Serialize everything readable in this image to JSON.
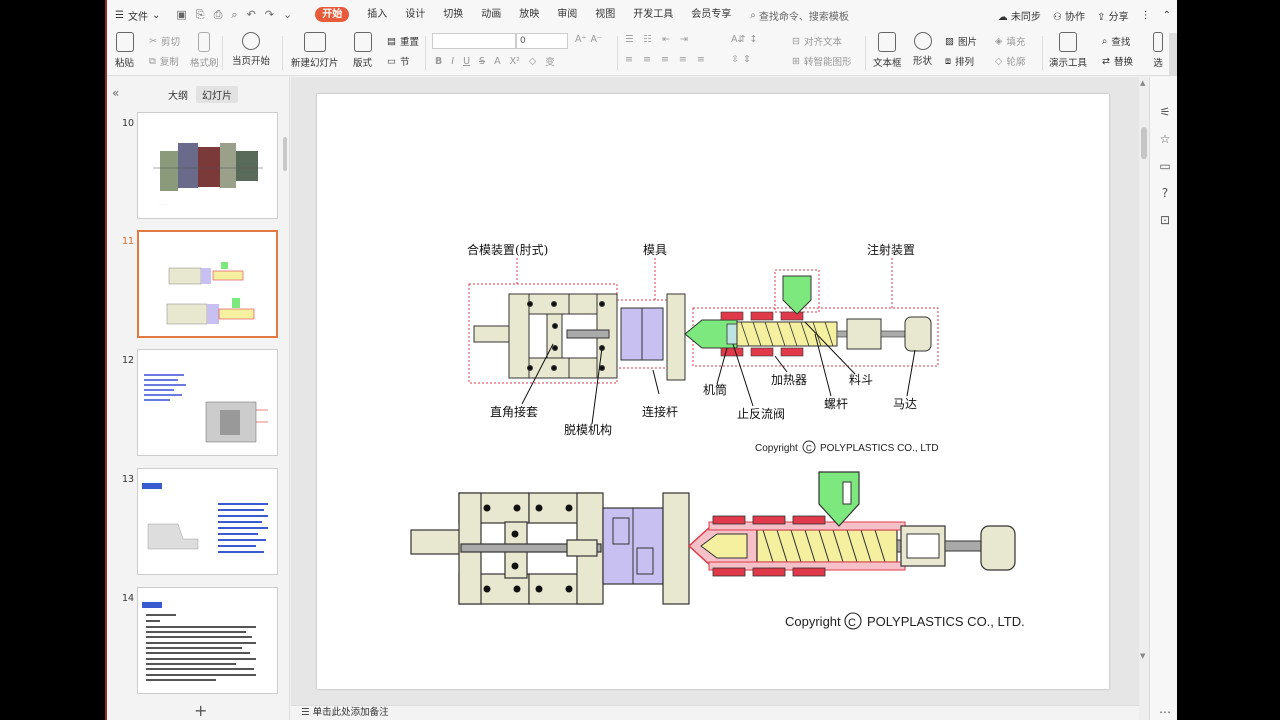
{
  "menubar": {
    "file_label": "文件",
    "tabs": [
      "开始",
      "插入",
      "设计",
      "切换",
      "动画",
      "放映",
      "审阅",
      "视图",
      "开发工具",
      "会员专享"
    ],
    "search_label": "查找命令、搜索模板",
    "sync_label": "未同步",
    "collab_label": "协作",
    "share_label": "分享"
  },
  "ribbon": {
    "paste": "粘贴",
    "cut": "剪切",
    "copy": "复制",
    "format_painter": "格式刷",
    "from_current": "当页开始",
    "new_slide": "新建幻灯片",
    "layout": "版式",
    "section": "节",
    "reset": "重置",
    "font_size": "0",
    "align_text": "对齐文本",
    "to_smartart": "转智能图形",
    "textbox": "文本框",
    "shape": "形状",
    "picture": "图片",
    "arrange": "排列",
    "fill": "填充",
    "outline": "轮廓",
    "presentation_tools": "演示工具",
    "find": "查找",
    "replace": "替换",
    "more": "选"
  },
  "left_panel": {
    "tab_outline": "大纲",
    "tab_slides": "幻灯片",
    "slides": [
      {
        "num": "10",
        "active": false
      },
      {
        "num": "11",
        "active": true
      },
      {
        "num": "12",
        "active": false
      },
      {
        "num": "13",
        "active": false
      },
      {
        "num": "14",
        "active": false
      }
    ],
    "add_slide": "+"
  },
  "slide": {
    "labels": {
      "clamping_unit": "合模装置(肘式)",
      "mold": "模具",
      "injection_unit": "注射装置",
      "barrel": "机筒",
      "heater": "加热器",
      "hopper": "料斗",
      "screw": "螺杆",
      "motor": "马达",
      "check_valve": "止反流阀",
      "tie_rod": "连接杆",
      "crosshead": "直角接套",
      "ejector": "脱模机构"
    },
    "copyright_small": "Copyright",
    "copyright_small_company": "POLYPLASTICS CO., LTD",
    "copyright_large": "Copyright",
    "copyright_large_company": "POLYPLASTICS CO., LTD."
  },
  "notes": {
    "placeholder": "单击此处添加备注"
  },
  "colors": {
    "accent": "#e85b3a",
    "mold_purple": "#c8c0f0",
    "heater_red": "#e03a4a",
    "hopper_green": "#7de87d",
    "screw_yellow": "#f5f0a0",
    "frame_beige": "#e8e8d0"
  }
}
